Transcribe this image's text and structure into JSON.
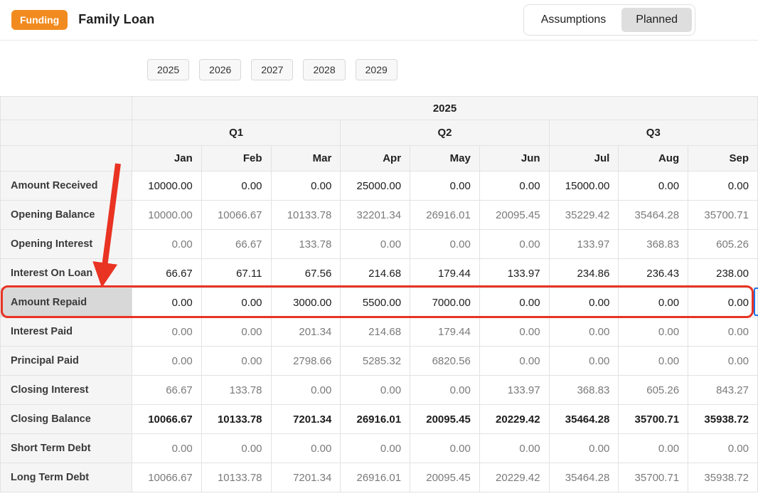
{
  "header": {
    "badge": "Funding",
    "title": "Family Loan",
    "tabs": [
      {
        "label": "Assumptions",
        "active": false
      },
      {
        "label": "Planned",
        "active": true
      }
    ]
  },
  "years": [
    "2025",
    "2026",
    "2027",
    "2028",
    "2029"
  ],
  "table": {
    "year_header": "2025",
    "quarters": [
      "Q1",
      "Q2",
      "Q3"
    ],
    "months": [
      "Jan",
      "Feb",
      "Mar",
      "Apr",
      "May",
      "Jun",
      "Jul",
      "Aug",
      "Sep"
    ],
    "rows": [
      {
        "label": "Amount Received",
        "style": "input",
        "highlight": false,
        "values": [
          "10000.00",
          "0.00",
          "0.00",
          "25000.00",
          "0.00",
          "0.00",
          "15000.00",
          "0.00",
          "0.00"
        ]
      },
      {
        "label": "Opening Balance",
        "style": "computed",
        "highlight": false,
        "values": [
          "10000.00",
          "10066.67",
          "10133.78",
          "32201.34",
          "26916.01",
          "20095.45",
          "35229.42",
          "35464.28",
          "35700.71"
        ]
      },
      {
        "label": "Opening Interest",
        "style": "computed",
        "highlight": false,
        "values": [
          "0.00",
          "66.67",
          "133.78",
          "0.00",
          "0.00",
          "0.00",
          "133.97",
          "368.83",
          "605.26"
        ]
      },
      {
        "label": "Interest On Loan",
        "style": "input",
        "highlight": false,
        "values": [
          "66.67",
          "67.11",
          "67.56",
          "214.68",
          "179.44",
          "133.97",
          "234.86",
          "236.43",
          "238.00"
        ]
      },
      {
        "label": "Amount Repaid",
        "style": "input",
        "highlight": true,
        "values": [
          "0.00",
          "0.00",
          "3000.00",
          "5500.00",
          "7000.00",
          "0.00",
          "0.00",
          "0.00",
          "0.00"
        ]
      },
      {
        "label": "Interest Paid",
        "style": "computed",
        "highlight": false,
        "values": [
          "0.00",
          "0.00",
          "201.34",
          "214.68",
          "179.44",
          "0.00",
          "0.00",
          "0.00",
          "0.00"
        ]
      },
      {
        "label": "Principal Paid",
        "style": "computed",
        "highlight": false,
        "values": [
          "0.00",
          "0.00",
          "2798.66",
          "5285.32",
          "6820.56",
          "0.00",
          "0.00",
          "0.00",
          "0.00"
        ]
      },
      {
        "label": "Closing Interest",
        "style": "computed",
        "highlight": false,
        "values": [
          "66.67",
          "133.78",
          "0.00",
          "0.00",
          "0.00",
          "133.97",
          "368.83",
          "605.26",
          "843.27"
        ]
      },
      {
        "label": "Closing Balance",
        "style": "total",
        "highlight": false,
        "values": [
          "10066.67",
          "10133.78",
          "7201.34",
          "26916.01",
          "20095.45",
          "20229.42",
          "35464.28",
          "35700.71",
          "35938.72"
        ]
      },
      {
        "label": "Short Term Debt",
        "style": "computed",
        "highlight": false,
        "values": [
          "0.00",
          "0.00",
          "0.00",
          "0.00",
          "0.00",
          "0.00",
          "0.00",
          "0.00",
          "0.00"
        ]
      },
      {
        "label": "Long Term Debt",
        "style": "computed",
        "highlight": false,
        "values": [
          "10066.67",
          "10133.78",
          "7201.34",
          "26916.01",
          "20095.45",
          "20229.42",
          "35464.28",
          "35700.71",
          "35938.72"
        ]
      }
    ]
  },
  "annotation": {
    "target_row": "Amount Repaid",
    "colors": {
      "accent_orange": "#f28b1f",
      "annotation_red": "#e93323",
      "selection_blue": "#1a73e8"
    }
  }
}
